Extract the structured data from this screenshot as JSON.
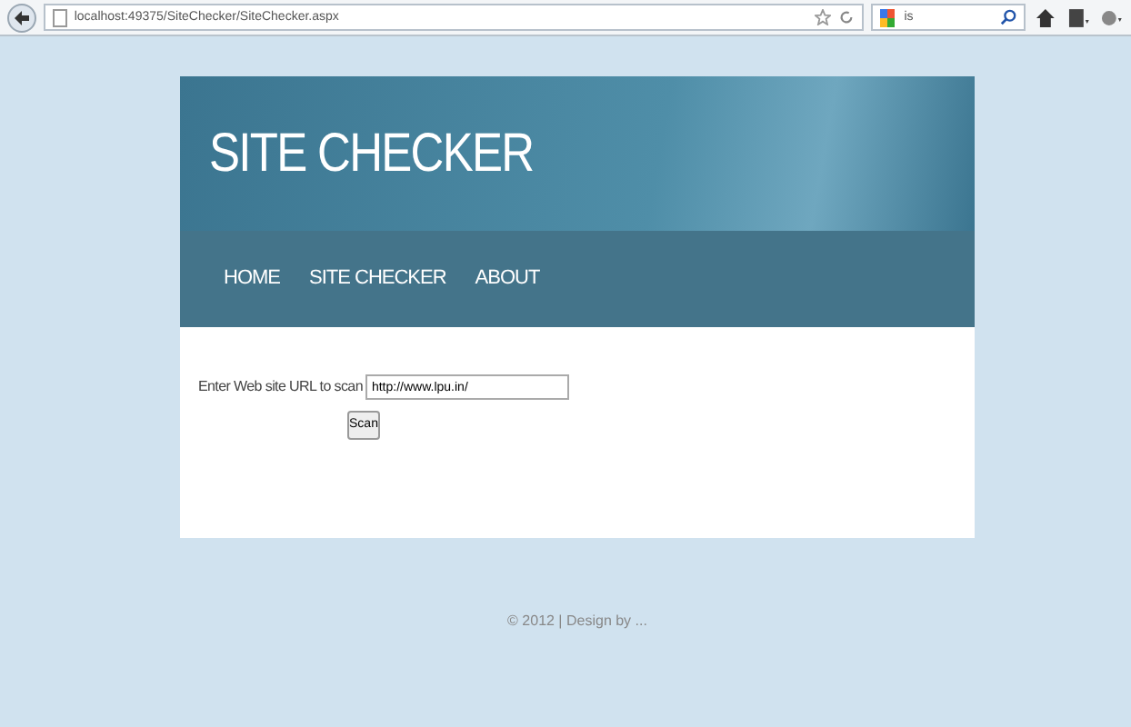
{
  "browser": {
    "url": "localhost:49375/SiteChecker/SiteChecker.aspx",
    "search": "is"
  },
  "site": {
    "title": "SITE CHECKER",
    "nav": [
      "HOME",
      "SITE CHECKER",
      "ABOUT"
    ],
    "form": {
      "label": "Enter Web site URL to scan",
      "value": "http://www.lpu.in/",
      "button": "Scan"
    },
    "footer": "© 2012 | Design by ..."
  }
}
